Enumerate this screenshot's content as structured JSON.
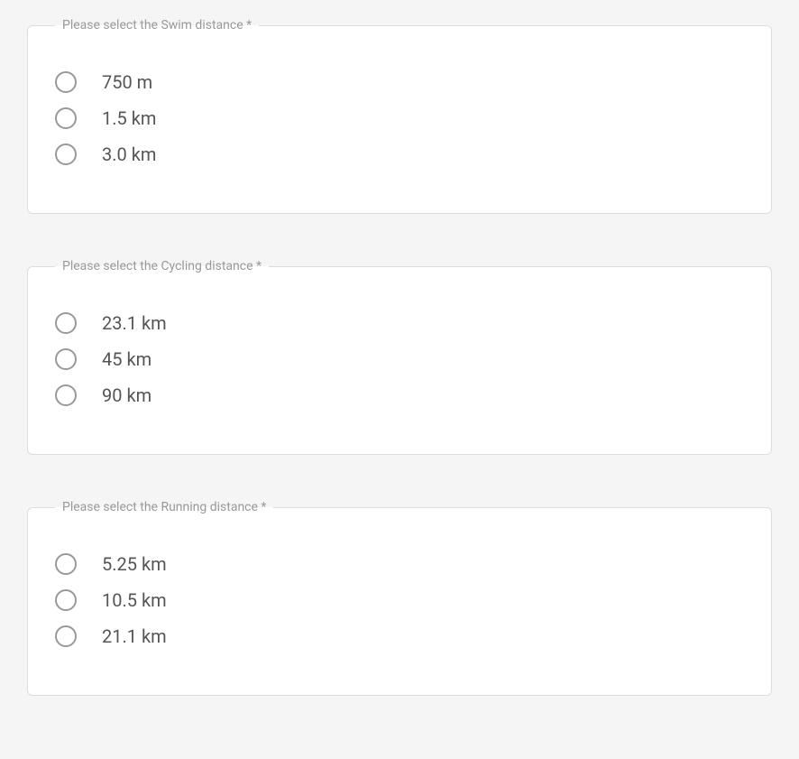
{
  "groups": [
    {
      "legend": "Please select the Swim distance *",
      "options": [
        "750 m",
        "1.5 km",
        "3.0 km"
      ]
    },
    {
      "legend": "Please select the Cycling distance *",
      "options": [
        "23.1 km",
        "45 km",
        "90 km"
      ]
    },
    {
      "legend": "Please select the Running distance *",
      "options": [
        "5.25 km",
        "10.5 km",
        "21.1 km"
      ]
    }
  ]
}
